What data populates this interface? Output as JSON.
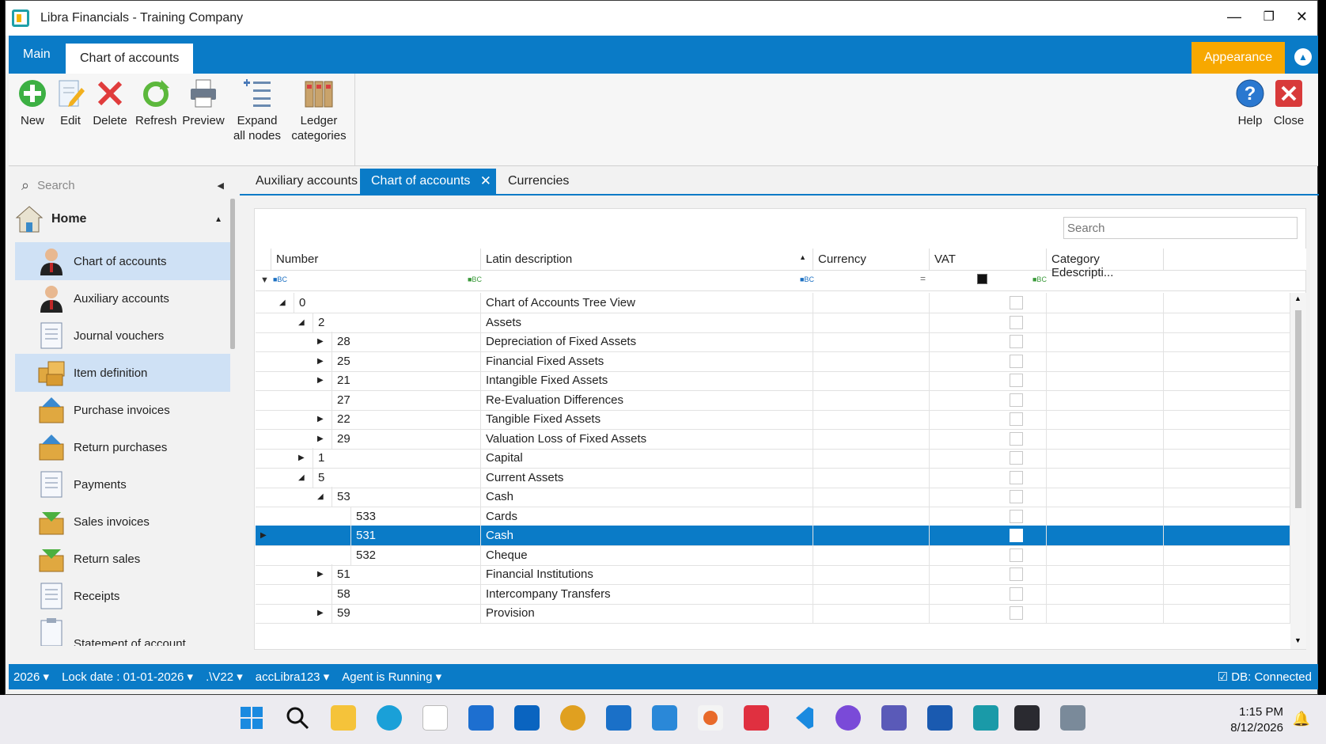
{
  "window": {
    "title": "Libra Financials - Training Company"
  },
  "ribbon_tabs": {
    "main": "Main",
    "active": "Chart of accounts",
    "appearance": "Appearance"
  },
  "ribbon": {
    "new": "New",
    "edit": "Edit",
    "delete": "Delete",
    "refresh": "Refresh",
    "preview": "Preview",
    "expand_1": "Expand",
    "expand_2": "all nodes",
    "ledger_1": "Ledger",
    "ledger_2": "categories",
    "help": "Help",
    "close": "Close"
  },
  "sidebar": {
    "search_placeholder": "Search",
    "home": "Home",
    "items": [
      {
        "label": "Chart of accounts"
      },
      {
        "label": "Auxiliary accounts"
      },
      {
        "label": "Journal vouchers"
      },
      {
        "label": "Item definition"
      },
      {
        "label": "Purchase invoices"
      },
      {
        "label": "Return purchases"
      },
      {
        "label": "Payments"
      },
      {
        "label": "Sales invoices"
      },
      {
        "label": "Return sales"
      },
      {
        "label": "Receipts"
      },
      {
        "label": "Statement of account"
      }
    ]
  },
  "doc_tabs": {
    "aux": "Auxiliary accounts",
    "coa": "Chart of accounts",
    "cur": "Currencies"
  },
  "grid": {
    "search_placeholder": "Search",
    "columns": [
      "Number",
      "Latin description",
      "Currency",
      "VAT",
      "Category Edescripti..."
    ],
    "rows": [
      {
        "number": "0",
        "description": "Chart of Accounts Tree View"
      },
      {
        "number": "2",
        "description": "Assets"
      },
      {
        "number": "28",
        "description": "Depreciation of Fixed Assets"
      },
      {
        "number": "25",
        "description": "Financial Fixed Assets"
      },
      {
        "number": "21",
        "description": "Intangible Fixed Assets"
      },
      {
        "number": "27",
        "description": "Re-Evaluation Differences"
      },
      {
        "number": "22",
        "description": "Tangible Fixed Assets"
      },
      {
        "number": "29",
        "description": "Valuation Loss of Fixed Assets"
      },
      {
        "number": "1",
        "description": "Capital"
      },
      {
        "number": "5",
        "description": "Current Assets"
      },
      {
        "number": "53",
        "description": "Cash"
      },
      {
        "number": "533",
        "description": "Cards"
      },
      {
        "number": "531",
        "description": "Cash"
      },
      {
        "number": "532",
        "description": "Cheque"
      },
      {
        "number": "51",
        "description": "Financial Institutions"
      },
      {
        "number": "58",
        "description": "Intercompany Transfers"
      },
      {
        "number": "59",
        "description": "Provision"
      }
    ]
  },
  "statusbar": {
    "year": "2026",
    "lock_date": "Lock date : 01-01-2026",
    "server": ".\\V22",
    "db": "accLibra123",
    "agent": "Agent is Running",
    "connection": "DB: Connected"
  },
  "taskbar": {
    "time": "1:15 PM",
    "date": "8/12/2026"
  },
  "colors": {
    "accent": "#0a7bc7",
    "appearance": "#f7a800",
    "selection": "#0a7bc7"
  }
}
